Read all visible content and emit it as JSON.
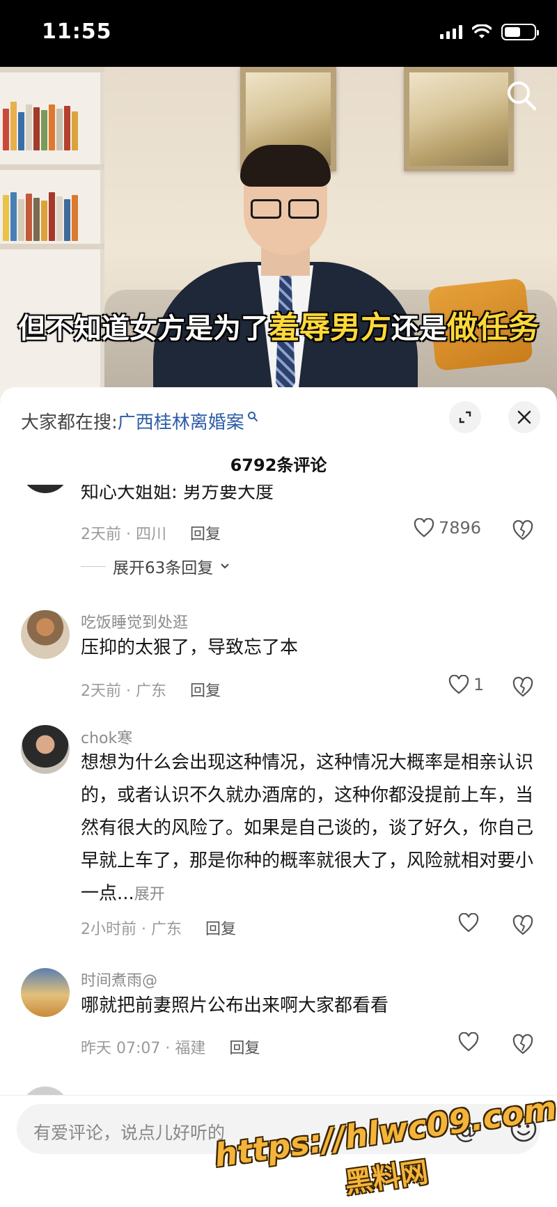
{
  "status_bar": {
    "time": "11:55"
  },
  "video": {
    "subtitle_parts": [
      "但不知道女方是为了",
      "羞辱男方",
      "还是",
      "做任务"
    ]
  },
  "search": {
    "prefix": "大家都在搜:",
    "query": "广西桂林离婚案"
  },
  "comments_header": {
    "count": "6792条评论"
  },
  "comments": [
    {
      "user": "",
      "text": "知心大姐姐: 男方要大度",
      "time_location": "2天前 · 四川",
      "reply": "回复",
      "likes": "7896",
      "expand": "展开63条回复"
    },
    {
      "user": "吃饭睡觉到处逛",
      "text": "压抑的太狠了，导致忘了本",
      "time_location": "2天前 · 广东",
      "reply": "回复",
      "likes": "1"
    },
    {
      "user": "chok寒",
      "text": "想想为什么会出现这种情况，这种情况大概率是相亲认识的，或者认识不久就办酒席的，这种你都没提前上车，当然有很大的风险了。如果是自己谈的，谈了好久，你自己早就上车了，那是你种的概率就很大了，风险就相对要小一点...",
      "more": "展开",
      "time_location": "2小时前 · 广东",
      "reply": "回复",
      "likes": ""
    },
    {
      "user": "时间煮雨@",
      "text": "哪就把前妻照片公布出来啊大家都看看",
      "time_location": "昨天 07:07 · 福建",
      "reply": "回复",
      "likes": ""
    }
  ],
  "input": {
    "placeholder": "有爱评论，说点儿好听的",
    "at": "@"
  },
  "watermark": {
    "url": "https://hlwc09.com",
    "name": "黑料网"
  },
  "colors": {
    "link": "#2d5da8",
    "subtitle_highlight": "#ffd83a",
    "watermark": "#f4b43a"
  }
}
